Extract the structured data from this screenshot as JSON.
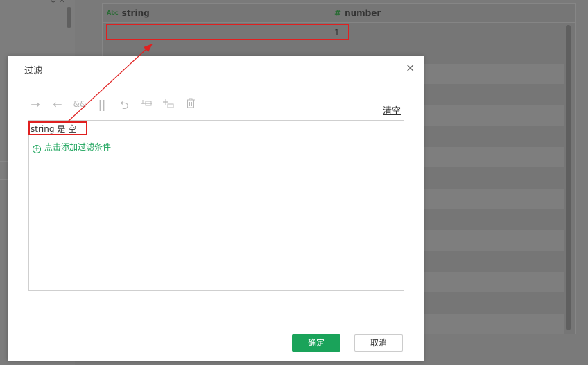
{
  "grid": {
    "columns": [
      {
        "type_icon": "Abc",
        "name": "string"
      },
      {
        "type_icon": "#",
        "name": "number"
      }
    ],
    "rows": [
      {
        "string": "",
        "number": "1"
      }
    ]
  },
  "dialog": {
    "title": "过滤",
    "close": "×",
    "clear_label": "清空",
    "condition": "string 是 空",
    "add_condition": "点击添加过滤条件",
    "ok_label": "确定",
    "cancel_label": "取消",
    "toolbar_icons": [
      "indent-right-icon",
      "indent-left-icon",
      "and-icon",
      "or-icon",
      "swap-icon",
      "insert-above-icon",
      "insert-below-icon",
      "delete-icon"
    ]
  },
  "colors": {
    "accent": "#1aa35a",
    "highlight": "#e02020"
  }
}
